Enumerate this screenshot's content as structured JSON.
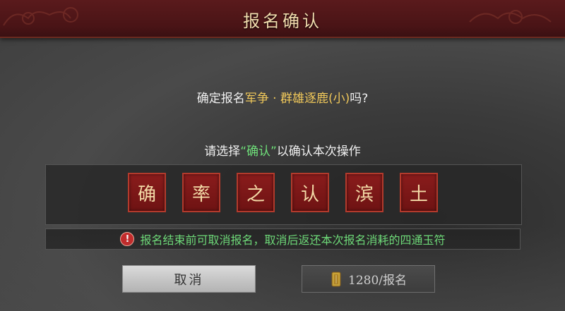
{
  "dialog": {
    "title": "报名确认",
    "question_prefix": "确定报名",
    "event_name": "军争 · 群雄逐鹿(小)",
    "question_suffix": "吗?",
    "instruction_prefix": "请选择",
    "instruction_keyword": "“确认”",
    "instruction_suffix": "以确认本次操作",
    "tiles": [
      "确",
      "率",
      "之",
      "认",
      "滨",
      "土"
    ],
    "warning_text": "报名结束前可取消报名，取消后返还本次报名消耗的四通玉符",
    "cancel_label": "取消",
    "signup_cost": "1280/报名"
  },
  "colors": {
    "header_bg": "#4a1416",
    "title": "#f2dcae",
    "event_highlight": "#f0c85a",
    "confirm_highlight": "#6fe07a",
    "tile_bg": "#7a1717",
    "warning_text": "#6fe07a"
  },
  "icons": {
    "warning": "exclamation-icon",
    "cost": "jade-token-icon"
  }
}
